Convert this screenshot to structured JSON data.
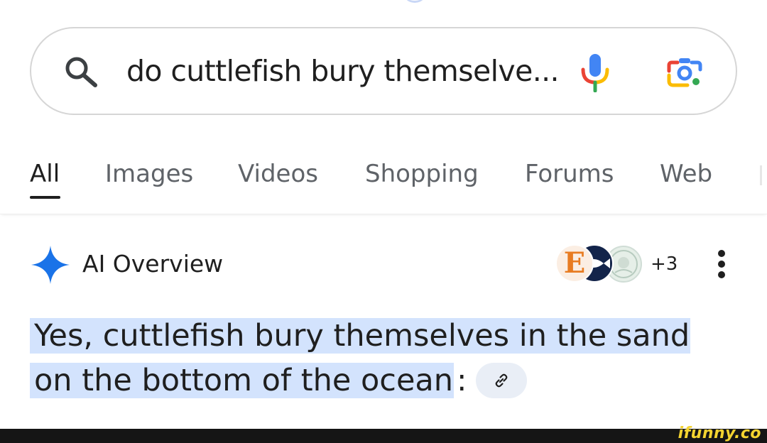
{
  "search": {
    "query": "do cuttlefish bury themselve..."
  },
  "icons": {
    "search": "search-icon",
    "mic": "microphone-icon",
    "lens": "google-lens-icon",
    "ai": "sparkle-icon",
    "more": "more-vert-icon",
    "link": "link-icon"
  },
  "tabs": [
    {
      "label": "All",
      "active": true
    },
    {
      "label": "Images"
    },
    {
      "label": "Videos"
    },
    {
      "label": "Shopping"
    },
    {
      "label": "Forums"
    },
    {
      "label": "Web"
    }
  ],
  "ai_overview": {
    "title": "AI Overview",
    "sources_more": "+3",
    "source_e_letter": "E",
    "answer_line1": "Yes, cuttlefish bury themselves in the sand",
    "answer_line2": "on the bottom of the ocean",
    "answer_colon": ":"
  },
  "watermark": {
    "text": "ifunny.co"
  },
  "colors": {
    "highlight": "#d3e3fd",
    "sparkle": "#1a73e8",
    "mic_blue": "#4285f4",
    "mic_red": "#ea4335",
    "mic_yellow": "#fbbc04",
    "mic_green": "#34a853",
    "watermark": "#f3d330"
  }
}
